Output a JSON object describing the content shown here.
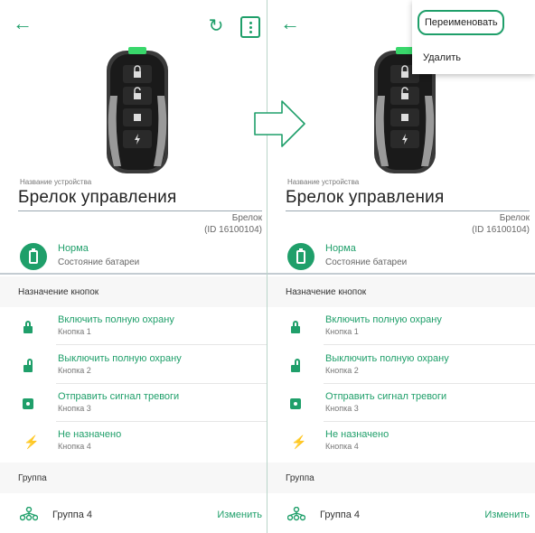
{
  "screens": [
    {
      "device": {
        "name_caption": "Название устройства",
        "name": "Брелок управления",
        "model": "Брелок",
        "id_text": "(ID 16100104)"
      },
      "battery": {
        "status": "Норма",
        "label": "Состояние батареи"
      },
      "buttons_section": {
        "title": "Назначение кнопок",
        "items": [
          {
            "title": "Включить полную охрану",
            "subtitle": "Кнопка 1",
            "icon": "lock-closed-icon"
          },
          {
            "title": "Выключить полную охрану",
            "subtitle": "Кнопка 2",
            "icon": "lock-open-icon"
          },
          {
            "title": "Отправить сигнал тревоги",
            "subtitle": "Кнопка 3",
            "icon": "alarm-icon"
          },
          {
            "title": "Не назначено",
            "subtitle": "Кнопка 4",
            "icon": "bolt-icon"
          }
        ]
      },
      "group_section": {
        "title": "Группа",
        "group_name": "Группа 4",
        "edit_label": "Изменить"
      }
    },
    {
      "device": {
        "name_caption": "Название устройства",
        "name": "Брелок управления",
        "model": "Брелок",
        "id_text": "(ID 16100104)"
      },
      "battery": {
        "status": "Норма",
        "label": "Состояние батареи"
      },
      "buttons_section": {
        "title": "Назначение кнопок",
        "items": [
          {
            "title": "Включить полную охрану",
            "subtitle": "Кнопка 1",
            "icon": "lock-closed-icon"
          },
          {
            "title": "Выключить полную охрану",
            "subtitle": "Кнопка 2",
            "icon": "lock-open-icon"
          },
          {
            "title": "Отправить сигнал тревоги",
            "subtitle": "Кнопка 3",
            "icon": "alarm-icon"
          },
          {
            "title": "Не назначено",
            "subtitle": "Кнопка 4",
            "icon": "bolt-icon"
          }
        ]
      },
      "group_section": {
        "title": "Группа",
        "group_name": "Группа 4",
        "edit_label": "Изменить"
      }
    }
  ],
  "menu": {
    "rename": "Переименовать",
    "delete": "Удалить"
  },
  "icons": {
    "back": "arrow-left-icon",
    "refresh": "refresh-icon",
    "more": "more-vertical-icon",
    "transition": "arrow-right-outline-icon",
    "group": "group-icon",
    "battery": "battery-icon"
  },
  "colors": {
    "accent": "#1f9f6a",
    "text": "#222222",
    "muted": "#777777"
  }
}
